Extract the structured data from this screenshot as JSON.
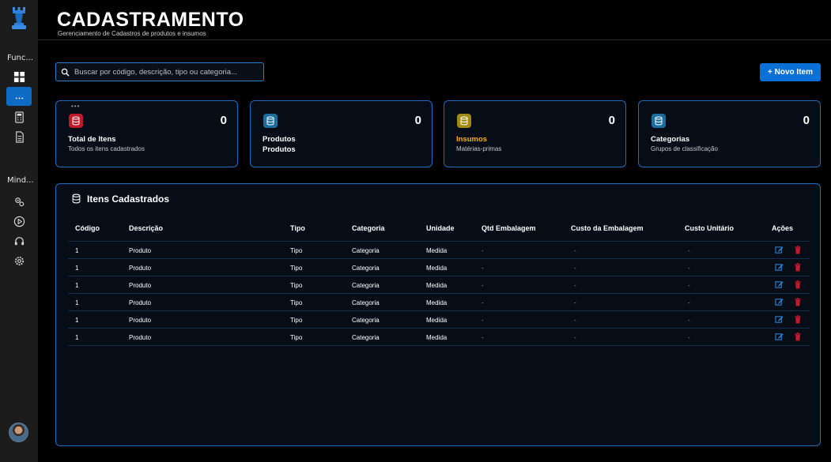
{
  "sidebar": {
    "section_functions": "Func...",
    "section_mind": "Mind..."
  },
  "header": {
    "title": "CADASTRAMENTO",
    "subtitle": "Gerenciamento de Cadastros de produtos e insumos"
  },
  "search": {
    "placeholder": "Buscar por código, descrição, tipo ou categoria..."
  },
  "new_item_label": "+ Novo Item",
  "cards": [
    {
      "label": "Total de Itens",
      "sub": "Todos os itens cadastrados",
      "count": "0",
      "color": "#c0192b"
    },
    {
      "label": "Produtos",
      "sub": "Produtos",
      "count": "0",
      "color": "#1f8fc9"
    },
    {
      "label": "Insumos",
      "sub": "Matérias-primas",
      "count": "0",
      "color": "#c9a411"
    },
    {
      "label": "Categorias",
      "sub": "Grupos de classificação",
      "count": "0",
      "color": "#1f8fc9"
    }
  ],
  "table": {
    "title": "Itens Cadastrados",
    "headers": [
      "Código",
      "Descrição",
      "Tipo",
      "Categoria",
      "Unidade",
      "Qtd Embalagem",
      "Custo da Embalagem",
      "Custo Unitário",
      "Ações"
    ],
    "rows": [
      [
        "1",
        "Produto",
        "Tipo",
        "Categoria",
        "Medida",
        "-",
        "-",
        "-"
      ],
      [
        "1",
        "Produto",
        "Tipo",
        "Categoria",
        "Medida",
        "-",
        "-",
        "-"
      ],
      [
        "1",
        "Produto",
        "Tipo",
        "Categoria",
        "Medida",
        "-",
        "-",
        "-"
      ],
      [
        "1",
        "Produto",
        "Tipo",
        "Categoria",
        "Medida",
        "-",
        "-",
        "-"
      ],
      [
        "1",
        "Produto",
        "Tipo",
        "Categoria",
        "Medida",
        "-",
        "-",
        "-"
      ],
      [
        "1",
        "Produto",
        "Tipo",
        "Categoria",
        "Medida",
        "-",
        "-",
        "-"
      ]
    ]
  },
  "colors": {
    "accent": "#0a6fd6",
    "border": "#1d6cc0",
    "insumos_label": "#f0b400",
    "delete": "#c0192b"
  }
}
